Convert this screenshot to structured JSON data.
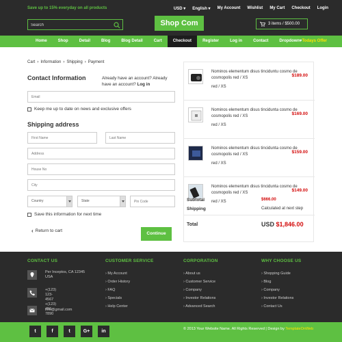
{
  "topbar": {
    "promo": "Save up to 15% everyday on all products",
    "currency": "USD",
    "language": "English",
    "links": [
      "My Account",
      "Wishlist",
      "My Cart",
      "Checkout",
      "Login"
    ]
  },
  "header": {
    "search_placeholder": "Search",
    "logo": "Shop Com",
    "cart": "3 items / $500.00"
  },
  "nav": {
    "items": [
      "Home",
      "Shop",
      "Detail",
      "Blog",
      "Blog Detail",
      "Cart",
      "Checkout",
      "Register",
      "Log in",
      "Contact",
      "Dropdown"
    ],
    "active": "Checkout",
    "offer": "Todays Offer"
  },
  "breadcrumb": [
    "Cart",
    "Information",
    "Shipping",
    "Payment"
  ],
  "contact": {
    "title": "Contact Information",
    "account_note": "Already have an account? Already have an account?",
    "login": "Log in",
    "email_placeholder": "Email",
    "newsletter": "Keep me up to date on news and exclusive offers"
  },
  "shipping": {
    "title": "Shipping address",
    "first_name": "First Name",
    "last_name": "Last Name",
    "address": "Address",
    "house_no": "House No",
    "city": "City",
    "country": "Country",
    "state": "State",
    "pin_code": "Pin Code",
    "save_info": "Save this information for next time",
    "back": "Return to cart",
    "continue": "Continue"
  },
  "cart_items": [
    {
      "name": "Nominos elementum disus tinciduntu cosmo de cosmopolis red / XS",
      "variant": "red / XS",
      "price": "$189.00"
    },
    {
      "name": "Nominos elementum disus tincidunta cosmo de cosmopolis red / XS",
      "variant": "red / XS",
      "price": "$169.00"
    },
    {
      "name": "Nominos elementum disus tincidunta cosmo de cosmopolis red / XS",
      "variant": "red / XS",
      "price": "$159.00"
    },
    {
      "name": "Nominos elementum disus tincidunta cosmo de cosmopolis red / XS",
      "variant": "red / XS",
      "price": "$149.00"
    }
  ],
  "summary": {
    "subtotal_label": "Subtotal",
    "subtotal": "$666.00",
    "shipping_label": "Shipping",
    "shipping": "Calculated at next step",
    "total_label": "Total",
    "total_currency": "USD",
    "total": "$1,846.00"
  },
  "footer": {
    "contact_head": "CONTACT US",
    "address": "Per Inceptos, CA 12345 USA",
    "phone1": "+(123) 123-4567",
    "phone2": "+(123) 456-7890",
    "email": "info@gmail.com",
    "service_head": "CUSTOMER SERVICE",
    "service_links": [
      "My Account",
      "Order History",
      "FAQ",
      "Specials",
      "Help Center"
    ],
    "corp_head": "CORPORATION",
    "corp_links": [
      "About us",
      "Customer Service",
      "Company",
      "Investor Relations",
      "Advanced Search"
    ],
    "why_head": "WHY CHOOSE US",
    "why_links": [
      "Shopping Guide",
      "Blog",
      "Company",
      "Investor Relations",
      "Contact Us"
    ],
    "copyright": "© 2013 Your Website Name. All Rights Reserved | Design by",
    "designer": "TemplateOnWeb",
    "socials": [
      "twitter",
      "facebook",
      "twitter",
      "google-plus",
      "linkedin"
    ]
  }
}
